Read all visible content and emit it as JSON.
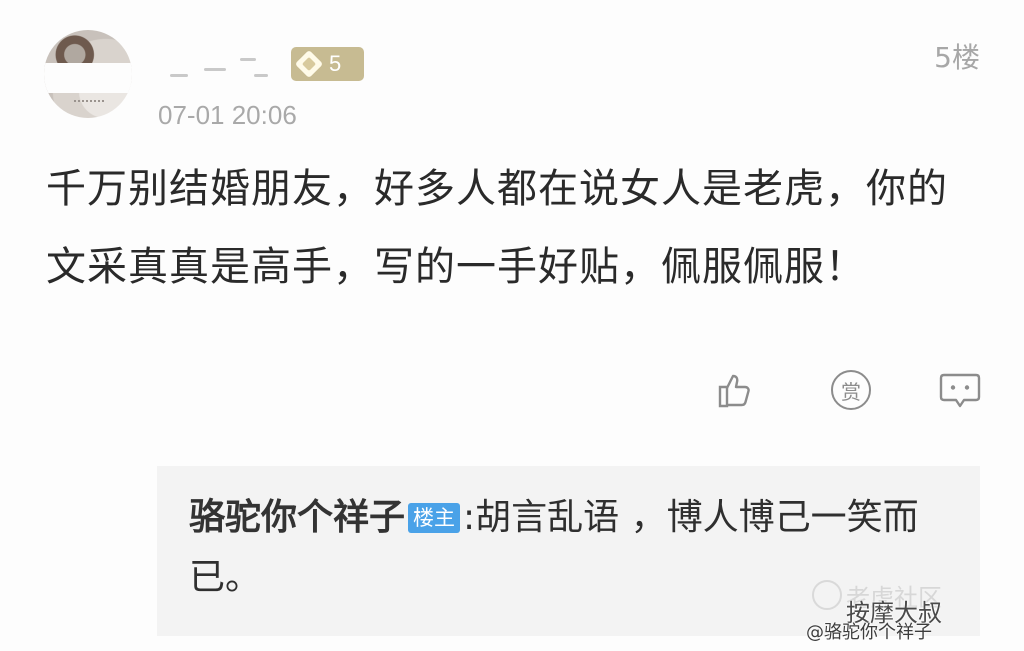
{
  "post": {
    "level": "5",
    "floor": "5楼",
    "timestamp": "07-01 20:06",
    "text": "千万别结婚朋友，好多人都在说女人是老虎，你的文采真真是高手，写的一手好贴，佩服佩服！"
  },
  "actions": {
    "like_icon": "thumbs-up-icon",
    "reward_label": "赏",
    "comment_icon": "comment-icon"
  },
  "reply": {
    "author": "骆驼你个祥子",
    "badge": "楼主",
    "text": ":胡言乱语 ，博人博己一笑而已。"
  },
  "watermark": {
    "line1": "老虎社区",
    "line2": "按摩大叔",
    "line3": "@骆驼你个祥子"
  },
  "colors": {
    "badge_blue": "#4aa2e8",
    "level_gold": "#c7bb92"
  }
}
